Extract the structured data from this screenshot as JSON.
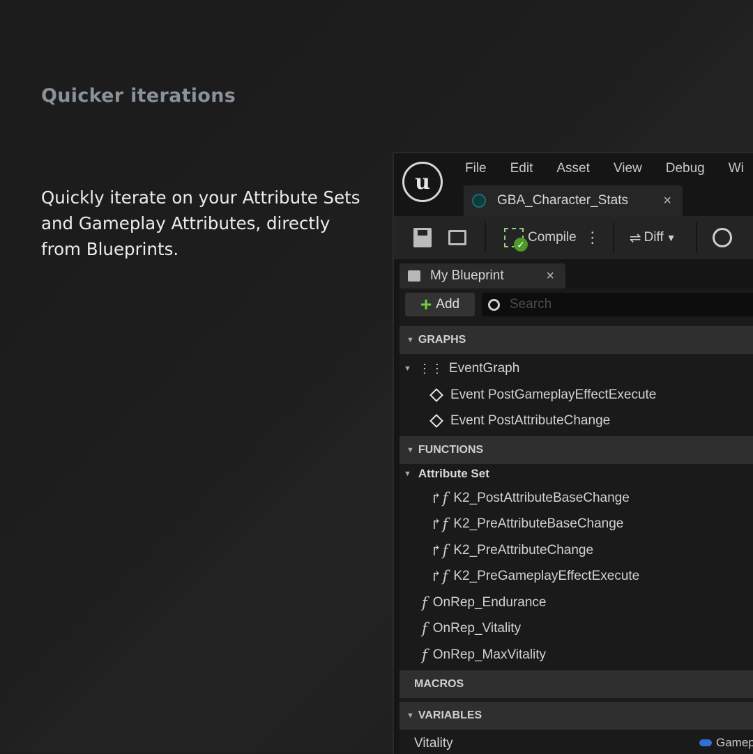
{
  "heading": "Quicker iterations",
  "blurb": "Quickly iterate on your Attribute Sets and Gameplay Attributes, directly from Blueprints.",
  "editor": {
    "menu": [
      "File",
      "Edit",
      "Asset",
      "View",
      "Debug",
      "Wi"
    ],
    "asset_tab": {
      "title": "GBA_Character_Stats",
      "close": "×"
    },
    "toolbar": {
      "compile_label": "Compile",
      "diff_label": "Diff"
    },
    "panel": {
      "tab_title": "My Blueprint",
      "tab_close": "×",
      "add_label": "Add",
      "search_placeholder": "Search",
      "sections": {
        "graphs": "GRAPHS",
        "functions": "FUNCTIONS",
        "macros": "MACROS",
        "variables": "VARIABLES"
      },
      "graphs": {
        "event_graph": "EventGraph",
        "events": [
          "Event PostGameplayEffectExecute",
          "Event PostAttributeChange"
        ]
      },
      "functions": {
        "group": "Attribute Set",
        "overrides": [
          "K2_PostAttributeBaseChange",
          "K2_PreAttributeBaseChange",
          "K2_PreAttributeChange",
          "K2_PreGameplayEffectExecute"
        ],
        "items": [
          "OnRep_Endurance",
          "OnRep_Vitality",
          "OnRep_MaxVitality"
        ]
      },
      "variables": [
        {
          "name": "Vitality",
          "type": "Gamep"
        }
      ]
    }
  },
  "colors": {
    "background": "#1c1c1c",
    "heading": "#8a919b",
    "accent_green": "#6fcf3a",
    "pin_blue": "#2f6fd6"
  }
}
